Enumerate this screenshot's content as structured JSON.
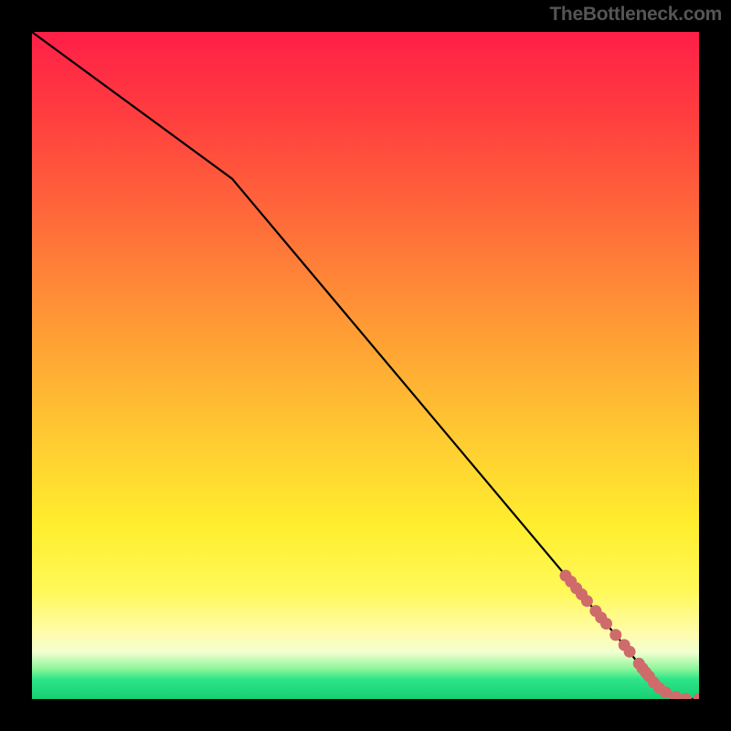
{
  "watermark": "TheBottleneck.com",
  "chart_data": {
    "type": "line",
    "title": "",
    "xlabel": "",
    "ylabel": "",
    "xlim": [
      0,
      100
    ],
    "ylim": [
      0,
      100
    ],
    "series": [
      {
        "name": "curve",
        "x": [
          0,
          30,
          88,
          92,
          95,
          98,
          100
        ],
        "y": [
          100,
          78,
          9,
          4,
          1,
          0,
          0
        ]
      }
    ],
    "markers": [
      {
        "x": 80.0,
        "y": 18.5
      },
      {
        "x": 80.8,
        "y": 17.6
      },
      {
        "x": 81.6,
        "y": 16.6
      },
      {
        "x": 82.4,
        "y": 15.7
      },
      {
        "x": 83.2,
        "y": 14.7
      },
      {
        "x": 84.5,
        "y": 13.2
      },
      {
        "x": 85.3,
        "y": 12.2
      },
      {
        "x": 86.1,
        "y": 11.3
      },
      {
        "x": 87.5,
        "y": 9.6
      },
      {
        "x": 88.8,
        "y": 8.1
      },
      {
        "x": 89.6,
        "y": 7.1
      },
      {
        "x": 91.0,
        "y": 5.3
      },
      {
        "x": 91.5,
        "y": 4.6
      },
      {
        "x": 92.0,
        "y": 4.0
      },
      {
        "x": 92.5,
        "y": 3.4
      },
      {
        "x": 93.2,
        "y": 2.5
      },
      {
        "x": 94.0,
        "y": 1.7
      },
      {
        "x": 95.0,
        "y": 1.0
      },
      {
        "x": 96.5,
        "y": 0.3
      },
      {
        "x": 98.0,
        "y": 0.0
      },
      {
        "x": 100.0,
        "y": 0.0
      }
    ],
    "colors": {
      "curve": "#000000",
      "markers": "#cf6b6b"
    }
  }
}
